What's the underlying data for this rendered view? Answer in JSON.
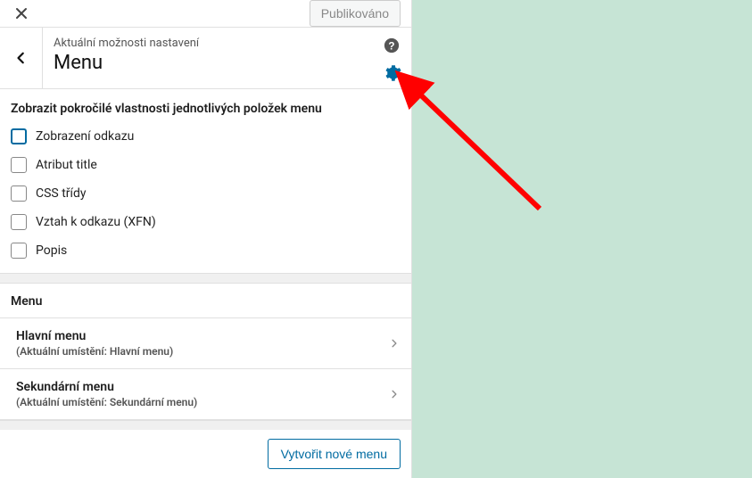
{
  "topbar": {
    "publish_label": "Publikováno"
  },
  "header": {
    "subtitle": "Aktuální možnosti nastavení",
    "title": "Menu"
  },
  "options": {
    "title": "Zobrazit pokročilé vlastnosti jednotlivých položek menu",
    "items": [
      {
        "label": "Zobrazení odkazu",
        "selected": true
      },
      {
        "label": "Atribut title",
        "selected": false
      },
      {
        "label": "CSS třídy",
        "selected": false
      },
      {
        "label": "Vztah k odkazu (XFN)",
        "selected": false
      },
      {
        "label": "Popis",
        "selected": false
      }
    ]
  },
  "menu_section": {
    "label": "Menu",
    "items": [
      {
        "title": "Hlavní menu",
        "subtitle": "(Aktuální umístění: Hlavní menu)"
      },
      {
        "title": "Sekundární menu",
        "subtitle": "(Aktuální umístění: Sekundární menu)"
      }
    ]
  },
  "footer": {
    "create_label": "Vytvořit nové menu"
  }
}
